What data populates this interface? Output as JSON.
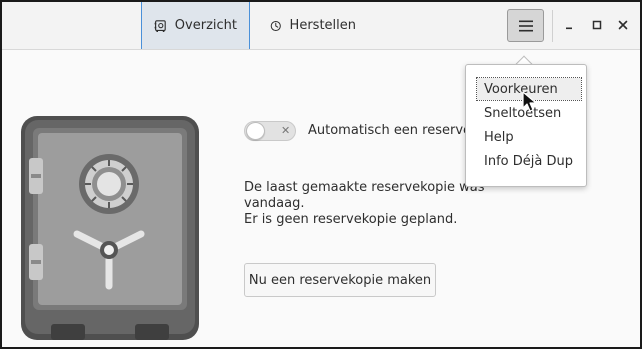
{
  "header": {
    "tabs": [
      {
        "label": "Overzicht",
        "icon": "safe-icon",
        "active": true
      },
      {
        "label": "Herstellen",
        "icon": "clock-icon",
        "active": false
      }
    ],
    "menu_button_icon": "hamburger-icon",
    "window_controls": [
      "minimize-icon",
      "maximize-icon",
      "close-icon"
    ]
  },
  "main": {
    "auto_backup_label": "Automatisch een reservek",
    "auto_backup_enabled": false,
    "status_lines": [
      "De laast gemaakte reservekopie was",
      "vandaag.",
      "Er is geen reservekopie gepland."
    ],
    "backup_now_label": "Nu een reservekopie maken"
  },
  "menu": {
    "items": [
      {
        "label": "Voorkeuren"
      },
      {
        "label": "Sneltoetsen"
      },
      {
        "label": "Help"
      },
      {
        "label": "Info Déjà Dup"
      }
    ]
  },
  "colors": {
    "accent": "#4a90d9",
    "headerbar": "#f3f3f3",
    "safe_body": "#5c5c5c",
    "safe_door": "#9b9b9b"
  }
}
